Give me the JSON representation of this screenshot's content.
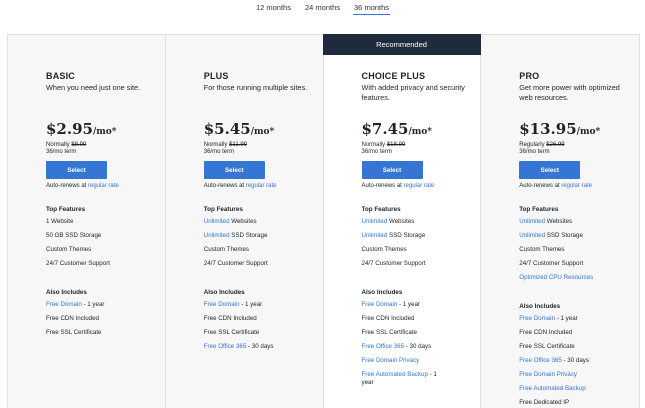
{
  "term_tabs": [
    {
      "label": "12 months",
      "active": false
    },
    {
      "label": "24 months",
      "active": false
    },
    {
      "label": "36 months",
      "active": true
    }
  ],
  "recommended_label": "Recommended",
  "select_label": "Select",
  "auto_renew_text": "Auto-renews at ",
  "regular_rate_link": "regular rate",
  "top_features_title": "Top Features",
  "also_includes_title": "Also Includes",
  "plans": [
    {
      "name": "BASIC",
      "desc": "When you need just one site.",
      "price": "$2.95",
      "per": "/mo*",
      "normally_label": "Normally ",
      "normal_price": "$8.99",
      "term": "36/mo term",
      "features": [
        {
          "link": "",
          "text": "1 Website"
        },
        {
          "link": "",
          "text": "50 GB SSD Storage"
        },
        {
          "link": "",
          "text": "Custom Themes"
        },
        {
          "link": "",
          "text": "24/7 Customer Support"
        }
      ],
      "includes": [
        {
          "link": "Free Domain",
          "text": " - 1 year"
        },
        {
          "link": "",
          "text": "Free CDN Included"
        },
        {
          "link": "",
          "text": "Free SSL Certificate"
        }
      ]
    },
    {
      "name": "PLUS",
      "desc": "For those running multiple sites.",
      "price": "$5.45",
      "per": "/mo*",
      "normally_label": "Normally ",
      "normal_price": "$11.99",
      "term": "36/mo term",
      "features": [
        {
          "link": "Unlimited",
          "text": " Websites"
        },
        {
          "link": "Unlimited",
          "text": " SSD Storage"
        },
        {
          "link": "",
          "text": "Custom Themes"
        },
        {
          "link": "",
          "text": "24/7 Customer Support"
        }
      ],
      "includes": [
        {
          "link": "Free Domain",
          "text": " - 1 year"
        },
        {
          "link": "",
          "text": "Free CDN Included"
        },
        {
          "link": "",
          "text": "Free SSL Certificate"
        },
        {
          "link": "Free Office 365",
          "text": " - 30 days"
        }
      ]
    },
    {
      "name": "CHOICE PLUS",
      "desc": "With added privacy and security features.",
      "price": "$7.45",
      "per": "/mo*",
      "normally_label": "Normally ",
      "normal_price": "$18.99",
      "term": "36/mo term",
      "features": [
        {
          "link": "Unlimited",
          "text": " Websites"
        },
        {
          "link": "Unlimited",
          "text": " SSD Storage"
        },
        {
          "link": "",
          "text": "Custom Themes"
        },
        {
          "link": "",
          "text": "24/7 Customer Support"
        }
      ],
      "includes": [
        {
          "link": "Free Domain",
          "text": " - 1 year"
        },
        {
          "link": "",
          "text": "Free CDN Included"
        },
        {
          "link": "",
          "text": "Free SSL Certificate"
        },
        {
          "link": "Free Office 365",
          "text": " - 30 days"
        },
        {
          "link": "Free Domain Privacy",
          "text": ""
        },
        {
          "link": "Free Automated Backup",
          "text": " - 1 year"
        }
      ]
    },
    {
      "name": "PRO",
      "desc": "Get more power with optimized web resources.",
      "price": "$13.95",
      "per": "/mo*",
      "normally_label": "Regularly ",
      "normal_price": "$26.99",
      "term": "36/mo term",
      "features": [
        {
          "link": "Unlimited",
          "text": " Websites"
        },
        {
          "link": "Unlimited",
          "text": " SSD Storage"
        },
        {
          "link": "",
          "text": "Custom Themes"
        },
        {
          "link": "",
          "text": "24/7 Customer Support"
        },
        {
          "link": "Optimized CPU Resources",
          "text": ""
        }
      ],
      "includes": [
        {
          "link": "Free Domain",
          "text": " - 1 year"
        },
        {
          "link": "",
          "text": "Free CDN Included"
        },
        {
          "link": "",
          "text": "Free SSL Certificate"
        },
        {
          "link": "Free Office 365",
          "text": " - 30 days"
        },
        {
          "link": "Free Domain Privacy",
          "text": ""
        },
        {
          "link": "Free Automated Backup",
          "text": ""
        },
        {
          "link": "",
          "text": "Free Dedicated IP"
        }
      ]
    }
  ],
  "colors": {
    "accent": "#3575d3",
    "banner": "#1e2b3c",
    "panel": "#f7f7f7"
  }
}
